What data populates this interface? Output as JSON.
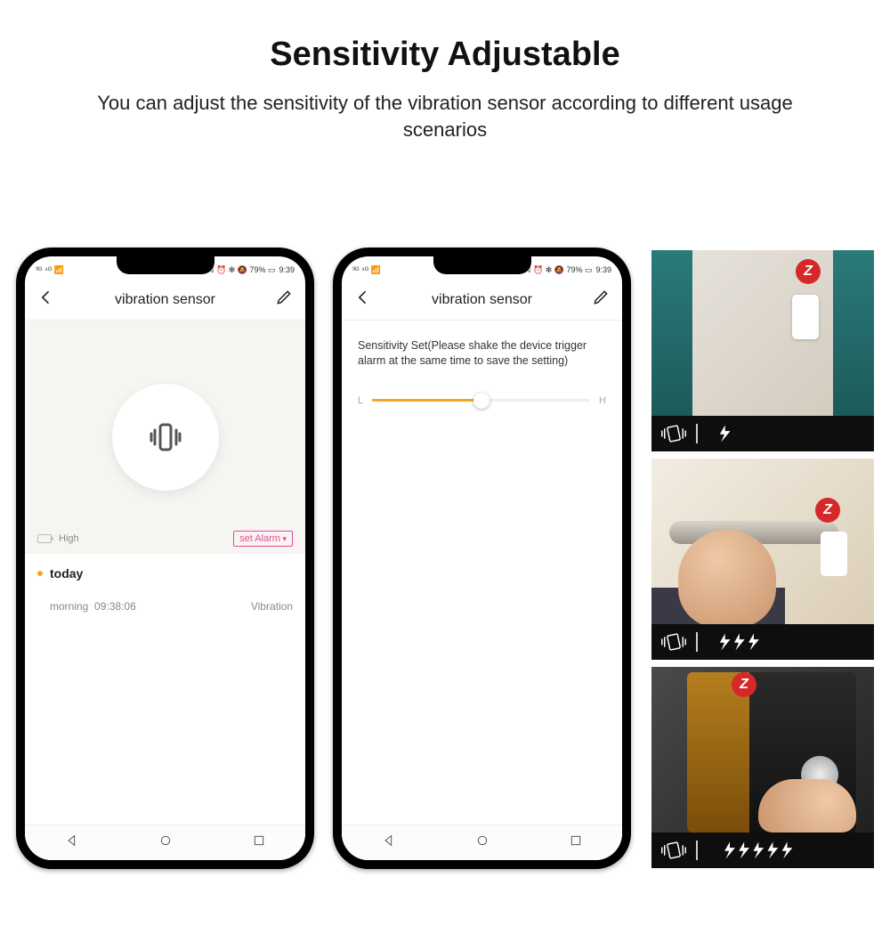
{
  "heading": "Sensitivity Adjustable",
  "subheading": "You can adjust the sensitivity of the vibration sensor according to different usage scenarios",
  "status": {
    "left": "³ᴳ ⁴ᴳ 📶",
    "right": "ℕ ⏰ ✻ 🔕 79% ▭",
    "time": "9:39"
  },
  "screen1": {
    "title": "vibration sensor",
    "battery_label": "High",
    "set_alarm": "set Alarm",
    "log_heading": "today",
    "entry_time_label": "morning",
    "entry_time": "09:38:06",
    "entry_type": "Vibration"
  },
  "screen2": {
    "title": "vibration sensor",
    "desc": "Sensitivity Set(Please shake the device trigger alarm at the same time to save the setting)",
    "low": "L",
    "high": "H"
  },
  "scenes": {
    "window_bolts": 1,
    "handle_bolts": 3,
    "safe_bolts": 5
  }
}
